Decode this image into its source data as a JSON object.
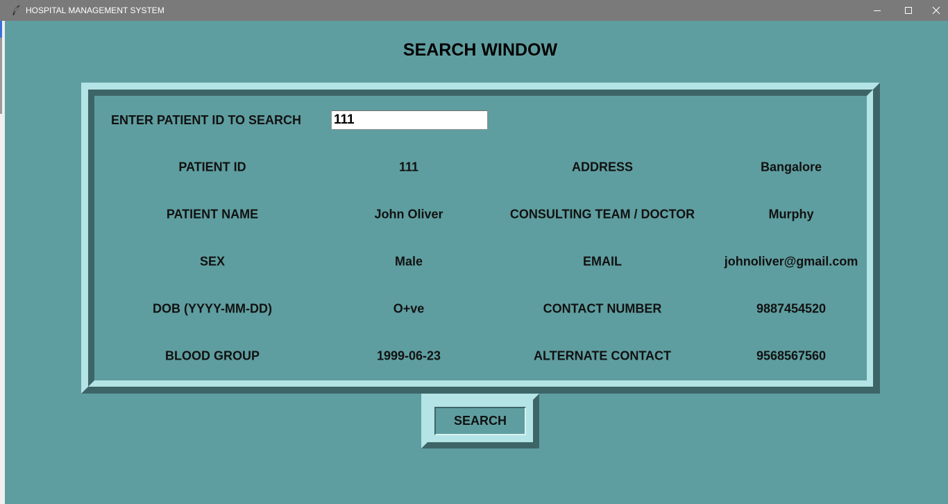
{
  "window": {
    "title": "HOSPITAL MANAGEMENT SYSTEM",
    "icon": "feather-icon",
    "controls": [
      "minimize-icon",
      "maximize-icon",
      "close-icon"
    ]
  },
  "page": {
    "heading": "SEARCH WINDOW"
  },
  "search": {
    "label": "ENTER PATIENT ID TO SEARCH",
    "value": "111",
    "button_label": "SEARCH"
  },
  "details": {
    "left": [
      {
        "label": "PATIENT ID",
        "value": "111"
      },
      {
        "label": "PATIENT NAME",
        "value": "John Oliver"
      },
      {
        "label": "SEX",
        "value": "Male"
      },
      {
        "label": "DOB (YYYY-MM-DD)",
        "value": "O+ve"
      },
      {
        "label": "BLOOD GROUP",
        "value": "1999-06-23"
      }
    ],
    "right": [
      {
        "label": "ADDRESS",
        "value": "Bangalore"
      },
      {
        "label": "CONSULTING TEAM / DOCTOR",
        "value": "Murphy"
      },
      {
        "label": "EMAIL",
        "value": "johnoliver@gmail.com"
      },
      {
        "label": "CONTACT NUMBER",
        "value": "9887454520"
      },
      {
        "label": "ALTERNATE CONTACT",
        "value": "9568567560"
      }
    ]
  },
  "colors": {
    "background": "#5f9ea0",
    "frame_light": "#b4e4e6",
    "frame_dark": "#3d6568",
    "titlebar": "#7a7a7a"
  }
}
